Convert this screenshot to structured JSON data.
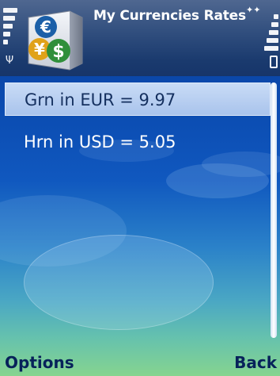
{
  "status": {
    "title": "My Currencies Rates",
    "signal_icon": "signal-strength-icon",
    "antenna_glyph": "Ψ",
    "bluetooth_icon": "bluetooth-icon",
    "bluetooth_glyph": "✦✦",
    "battery_icon": "battery-icon"
  },
  "app_icon": {
    "name": "currency-app-icon",
    "symbols": [
      "€",
      "¥",
      "$"
    ],
    "colors": {
      "euro": "#1b5fa8",
      "yen": "#e0a21a",
      "dollar": "#2f8f3a"
    }
  },
  "rates": [
    {
      "label": "Grn in  EUR = 9.97",
      "selected": true
    },
    {
      "label": "Hrn in  USD = 5.05",
      "selected": false
    }
  ],
  "softkeys": {
    "left": "Options",
    "right": "Back"
  },
  "colors": {
    "background_top": "#0a3f9a",
    "background_bottom": "#86d48f",
    "highlight": "#b5cdf0",
    "softkey_text": "#07225a"
  }
}
